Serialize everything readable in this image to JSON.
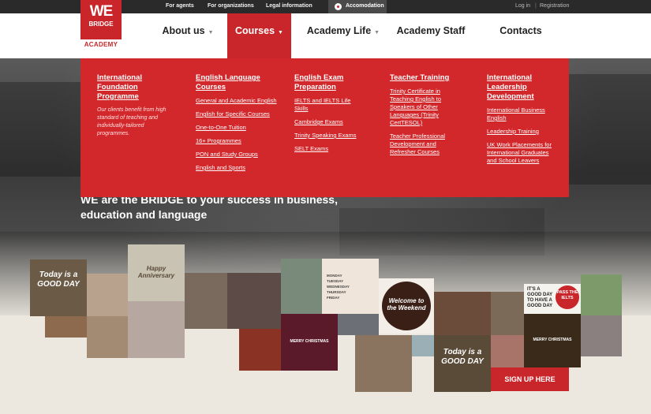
{
  "topbar": {
    "for_agents": "For agents",
    "for_organizations": "For organizations",
    "legal": "Legal information",
    "accommodation": "Accomodation",
    "login": "Log in",
    "separator": "|",
    "registration": "Registration"
  },
  "logo": {
    "we": "WE",
    "bridge": "BRIDGE",
    "academy": "ACADEMY"
  },
  "nav": {
    "about": "About us",
    "courses": "Courses",
    "academy_life": "Academy Life",
    "academy_staff": "Academy Staff",
    "contacts": "Contacts",
    "caret": "▼"
  },
  "mega": {
    "col1": {
      "title": "International Foundation Programme",
      "desc": "Our clients benefit from high standard of teaching and individually-tailored programmes."
    },
    "col2": {
      "title": "English Language Courses",
      "links": [
        "General and Academic English",
        "English for Specific Courses",
        "One-to-One Tuition",
        "16+ Programmes",
        "PON and Study Groups",
        "English and Sports"
      ]
    },
    "col3": {
      "title": "English Exam Preparation",
      "links": [
        "IELTS and IELTS Life Skills",
        "Cambridge Exams",
        "Trinity Speaking Exams",
        "SELT Exams"
      ]
    },
    "col4": {
      "title": "Teacher Training",
      "links": [
        "Trinity Certificate in Teaching English to Speakers of Other Languages (Trinity CertTESOL)",
        "Teacher Professional Development and Refresher Courses"
      ]
    },
    "col5": {
      "title": "International Leadership Development",
      "links": [
        "International Business English",
        "Leadership Training",
        "UK Work Placements for International Graduates and School Leavers"
      ]
    }
  },
  "hero": {
    "tagline": "WE are the BRIDGE to your success in business, education and language"
  },
  "tiles": {
    "today1": "Today is a GOOD DAY",
    "anniversary": "Happy Anniversary",
    "weekend": "Welcome to the Weekend",
    "christmas1": "MERRY CHRISTMAS",
    "christmas2": "MERRY CHRISTMAS",
    "today2": "Today is a GOOD DAY",
    "good_day": "IT'S A GOOD DAY TO HAVE A GOOD DAY",
    "pass_ielts": "PASS THE IELTS",
    "days": [
      "MONDAY",
      "TUESDAY",
      "WEDNESDAY",
      "THURSDAY",
      "FRIDAY"
    ]
  },
  "signup": "SIGN UP HERE",
  "colors": {
    "brand_red": "#c8262b",
    "menu_red": "#d2272b",
    "topbar": "#2a2a2a"
  }
}
